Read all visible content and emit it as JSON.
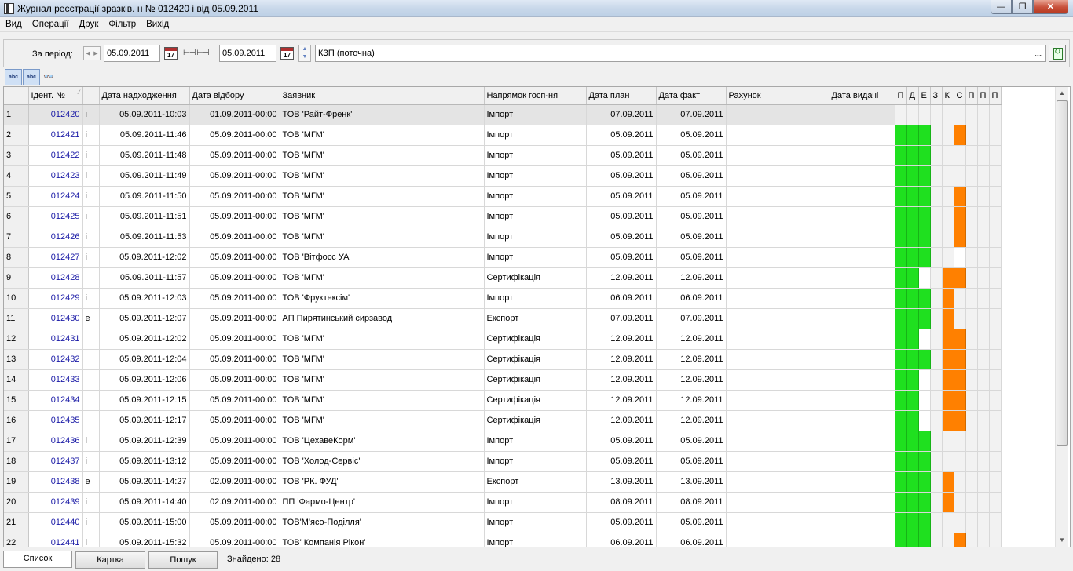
{
  "window": {
    "title": "Журнал реєстрації зразків. н № 012420 і від 05.09.2011",
    "minimize": "—",
    "maximize": "❐",
    "close": "✕"
  },
  "menu": [
    "Вид",
    "Операції",
    "Друк",
    "Фільтр",
    "Вихід"
  ],
  "toolbar": {
    "period_label": "За період:",
    "date_from": "05.09.2011",
    "date_to": "05.09.2011",
    "range_icon": "⊢⊣ ⊢⊣",
    "cal_from": "17",
    "cal_to": "17",
    "org": "КЗП (поточна)",
    "ellipsis": "...",
    "prev": "◀",
    "next": "▶",
    "up": "▲",
    "down": "▼"
  },
  "icons": {
    "abc_sort": "abc",
    "abc_filter": "abc",
    "glasses": "👓"
  },
  "columns": [
    "",
    "Ідент. №",
    "",
    "Дата надходження",
    "Дата відбору",
    "Заявник",
    "Напрямок госп-ня",
    "Дата план",
    "Дата факт",
    "Рахунок",
    "Дата видачі",
    "П",
    "Д",
    "Е",
    "З",
    "К",
    "С",
    "П",
    "П",
    "П"
  ],
  "status_colors": {
    "G": "#1fe01f",
    "O": "#ff8000",
    "W": "#ffffff",
    "L": "#f2f2f2"
  },
  "rows": [
    {
      "n": "1",
      "id": "012420",
      "t": "і",
      "recv": "05.09.2011-10:03",
      "sel": "01.09.2011-00:00",
      "client": "ТОВ 'Райт-Френк'",
      "dir": "Імпорт",
      "plan": "07.09.2011",
      "fact": "07.09.2011",
      "st": "LLLLLLLLL"
    },
    {
      "n": "2",
      "id": "012421",
      "t": "і",
      "recv": "05.09.2011-11:46",
      "sel": "05.09.2011-00:00",
      "client": "ТОВ 'МГМ'",
      "dir": "Імпорт",
      "plan": "05.09.2011",
      "fact": "05.09.2011",
      "st": "GGGLLOLLL"
    },
    {
      "n": "3",
      "id": "012422",
      "t": "і",
      "recv": "05.09.2011-11:48",
      "sel": "05.09.2011-00:00",
      "client": "ТОВ 'МГМ'",
      "dir": "Імпорт",
      "plan": "05.09.2011",
      "fact": "05.09.2011",
      "st": "GGGLLLLLL"
    },
    {
      "n": "4",
      "id": "012423",
      "t": "і",
      "recv": "05.09.2011-11:49",
      "sel": "05.09.2011-00:00",
      "client": "ТОВ 'МГМ'",
      "dir": "Імпорт",
      "plan": "05.09.2011",
      "fact": "05.09.2011",
      "st": "GGGLLLLLL"
    },
    {
      "n": "5",
      "id": "012424",
      "t": "і",
      "recv": "05.09.2011-11:50",
      "sel": "05.09.2011-00:00",
      "client": "ТОВ 'МГМ'",
      "dir": "Імпорт",
      "plan": "05.09.2011",
      "fact": "05.09.2011",
      "st": "GGGLLOLLL"
    },
    {
      "n": "6",
      "id": "012425",
      "t": "і",
      "recv": "05.09.2011-11:51",
      "sel": "05.09.2011-00:00",
      "client": "ТОВ 'МГМ'",
      "dir": "Імпорт",
      "plan": "05.09.2011",
      "fact": "05.09.2011",
      "st": "GGGLLOLLL"
    },
    {
      "n": "7",
      "id": "012426",
      "t": "і",
      "recv": "05.09.2011-11:53",
      "sel": "05.09.2011-00:00",
      "client": "ТОВ 'МГМ'",
      "dir": "Імпорт",
      "plan": "05.09.2011",
      "fact": "05.09.2011",
      "st": "GGGLLOLLL"
    },
    {
      "n": "8",
      "id": "012427",
      "t": "і",
      "recv": "05.09.2011-12:02",
      "sel": "05.09.2011-00:00",
      "client": "ТОВ 'Вітфосс УА'",
      "dir": "Імпорт",
      "plan": "05.09.2011",
      "fact": "05.09.2011",
      "st": "GGGLLWLLL"
    },
    {
      "n": "9",
      "id": "012428",
      "t": "",
      "recv": "05.09.2011-11:57",
      "sel": "05.09.2011-00:00",
      "client": "ТОВ 'МГМ'",
      "dir": "Сертифікація",
      "plan": "12.09.2011",
      "fact": "12.09.2011",
      "st": "GGWLOOLLL"
    },
    {
      "n": "10",
      "id": "012429",
      "t": "і",
      "recv": "05.09.2011-12:03",
      "sel": "05.09.2011-00:00",
      "client": "ТОВ 'Фруктексім'",
      "dir": "Імпорт",
      "plan": "06.09.2011",
      "fact": "06.09.2011",
      "st": "GGGLOLLLL"
    },
    {
      "n": "11",
      "id": "012430",
      "t": "е",
      "recv": "05.09.2011-12:07",
      "sel": "05.09.2011-00:00",
      "client": "АП Пирятинський сирзавод",
      "dir": "Експорт",
      "plan": "07.09.2011",
      "fact": "07.09.2011",
      "st": "GGGLOLLLL"
    },
    {
      "n": "12",
      "id": "012431",
      "t": "",
      "recv": "05.09.2011-12:02",
      "sel": "05.09.2011-00:00",
      "client": "ТОВ 'МГМ'",
      "dir": "Сертифікація",
      "plan": "12.09.2011",
      "fact": "12.09.2011",
      "st": "GGWLOOLLL"
    },
    {
      "n": "13",
      "id": "012432",
      "t": "",
      "recv": "05.09.2011-12:04",
      "sel": "05.09.2011-00:00",
      "client": "ТОВ 'МГМ'",
      "dir": "Сертифікація",
      "plan": "12.09.2011",
      "fact": "12.09.2011",
      "st": "GGGLOOLLL"
    },
    {
      "n": "14",
      "id": "012433",
      "t": "",
      "recv": "05.09.2011-12:06",
      "sel": "05.09.2011-00:00",
      "client": "ТОВ 'МГМ'",
      "dir": "Сертифікація",
      "plan": "12.09.2011",
      "fact": "12.09.2011",
      "st": "GGWLOOLLL"
    },
    {
      "n": "15",
      "id": "012434",
      "t": "",
      "recv": "05.09.2011-12:15",
      "sel": "05.09.2011-00:00",
      "client": "ТОВ 'МГМ'",
      "dir": "Сертифікація",
      "plan": "12.09.2011",
      "fact": "12.09.2011",
      "st": "GGWLOOLLL"
    },
    {
      "n": "16",
      "id": "012435",
      "t": "",
      "recv": "05.09.2011-12:17",
      "sel": "05.09.2011-00:00",
      "client": "ТОВ 'МГМ'",
      "dir": "Сертифікація",
      "plan": "12.09.2011",
      "fact": "12.09.2011",
      "st": "GGWLOOLLL"
    },
    {
      "n": "17",
      "id": "012436",
      "t": "і",
      "recv": "05.09.2011-12:39",
      "sel": "05.09.2011-00:00",
      "client": "ТОВ 'ЦехавеКорм'",
      "dir": "Імпорт",
      "plan": "05.09.2011",
      "fact": "05.09.2011",
      "st": "GGGLLLLLL"
    },
    {
      "n": "18",
      "id": "012437",
      "t": "і",
      "recv": "05.09.2011-13:12",
      "sel": "05.09.2011-00:00",
      "client": "ТОВ 'Холод-Сервіс'",
      "dir": "Імпорт",
      "plan": "05.09.2011",
      "fact": "05.09.2011",
      "st": "GGGLLLLLL"
    },
    {
      "n": "19",
      "id": "012438",
      "t": "е",
      "recv": "05.09.2011-14:27",
      "sel": "02.09.2011-00:00",
      "client": "ТОВ 'РК. ФУД'",
      "dir": "Експорт",
      "plan": "13.09.2011",
      "fact": "13.09.2011",
      "st": "GGGLOLLLL"
    },
    {
      "n": "20",
      "id": "012439",
      "t": "і",
      "recv": "05.09.2011-14:40",
      "sel": "02.09.2011-00:00",
      "client": "ПП 'Фармо-Центр'",
      "dir": "Імпорт",
      "plan": "08.09.2011",
      "fact": "08.09.2011",
      "st": "GGGLOLLLL"
    },
    {
      "n": "21",
      "id": "012440",
      "t": "і",
      "recv": "05.09.2011-15:00",
      "sel": "05.09.2011-00:00",
      "client": "ТОВ'М'ясо-Поділля'",
      "dir": "Імпорт",
      "plan": "05.09.2011",
      "fact": "05.09.2011",
      "st": "GGGLLLLLL"
    },
    {
      "n": "22",
      "id": "012441",
      "t": "і",
      "recv": "05.09.2011-15:32",
      "sel": "05.09.2011-00:00",
      "client": "ТОВ' Компанія Рікон'",
      "dir": "Імпорт",
      "plan": "06.09.2011",
      "fact": "06.09.2011",
      "st": "GGGLLOLLL"
    }
  ],
  "bottom": {
    "tab_list": "Список",
    "tab_card": "Картка",
    "tab_search": "Пошук",
    "found": "Знайдено: 28"
  },
  "scroll": {
    "up": "▲",
    "down": "▼"
  }
}
